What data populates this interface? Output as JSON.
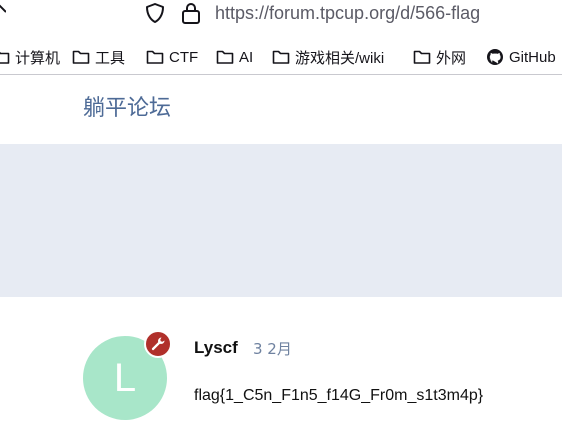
{
  "browser": {
    "url": "https://forum.tpcup.org/d/566-flag",
    "bookmarks": [
      {
        "label": "计算机",
        "icon": "folder-icon"
      },
      {
        "label": "工具",
        "icon": "folder-icon"
      },
      {
        "label": "CTF",
        "icon": "folder-icon"
      },
      {
        "label": "AI",
        "icon": "folder-icon"
      },
      {
        "label": "游戏相关/wiki",
        "icon": "folder-icon"
      },
      {
        "label": "外网",
        "icon": "folder-icon"
      },
      {
        "label": "GitHub",
        "icon": "github-icon"
      }
    ]
  },
  "forum": {
    "site_title": "躺平论坛"
  },
  "post": {
    "avatar_letter": "L",
    "username": "Lyscf",
    "date": "3 2月",
    "body": "flag{1_C5n_F1n5_f14G_Fr0m_s1t3m4p}"
  },
  "colors": {
    "avatar_bg": "#a8e6c9",
    "mod_badge": "#b0302b",
    "title_color": "#4d6a96",
    "hero_bg": "#e7ebf3"
  }
}
